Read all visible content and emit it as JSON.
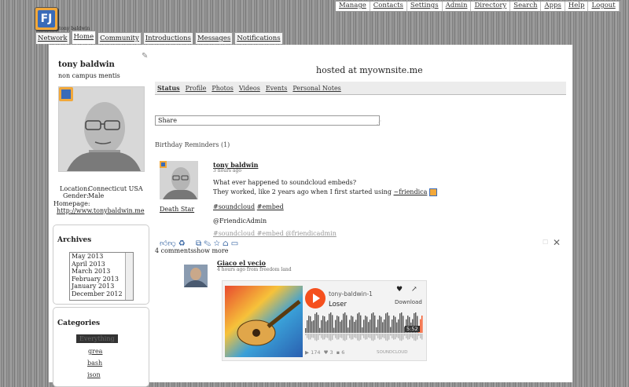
{
  "top_nav": [
    "Manage",
    "Contacts",
    "Settings",
    "Admin",
    "Directory",
    "Search",
    "Apps",
    "Help",
    "Logout"
  ],
  "logo_text": "FJ",
  "site_small": "tony baldwin",
  "tabs": [
    "Network",
    "Home",
    "Community",
    "Introductions",
    "Messages",
    "Notifications"
  ],
  "profile": {
    "name": "tony baldwin",
    "tagline": "non campus mentis",
    "location_label": "Location:",
    "location": "Connecticut USA",
    "gender_label": "Gender:",
    "gender": "Male",
    "homepage_label": "Homepage:",
    "homepage": "http://www.tonybaldwin.me"
  },
  "archives": {
    "title": "Archives",
    "items": [
      "May 2013",
      "April 2013",
      "March 2013",
      "February 2013",
      "January 2013",
      "December 2012"
    ]
  },
  "categories": {
    "title": "Categories",
    "items": [
      "Everything",
      "grea",
      "bash",
      "ison"
    ]
  },
  "hosted": "hosted at myownsite.me",
  "subtabs": [
    "Status",
    "Profile",
    "Photos",
    "Videos",
    "Events",
    "Personal Notes"
  ],
  "share_placeholder": "Share",
  "birthday": "Birthday Reminders (1)",
  "post": {
    "author": "tony baldwin",
    "time": "3 hours ago",
    "line1": "What ever happened to soundcloud embeds?",
    "line2": "They worked, like 2 years ago when I first started using",
    "link": "~friendica",
    "tags": [
      "#soundcloud",
      "#embed"
    ],
    "mention": "@FriendicAdmin",
    "tags2": "#soundcloud #embed @friendicadmin",
    "avatar_label": "Death Star",
    "comments": "4 comments",
    "show_more": "show more"
  },
  "comment": {
    "author": "Giaco el vecio",
    "time": "4 hours ago from freedom land"
  },
  "soundcloud": {
    "artist": "tony-baldwin-1",
    "track": "Loser",
    "download": "Download",
    "duration": "5:52",
    "plays": "174",
    "likes": "3",
    "comments": "6",
    "brand": "SOUNDCLOUD"
  }
}
